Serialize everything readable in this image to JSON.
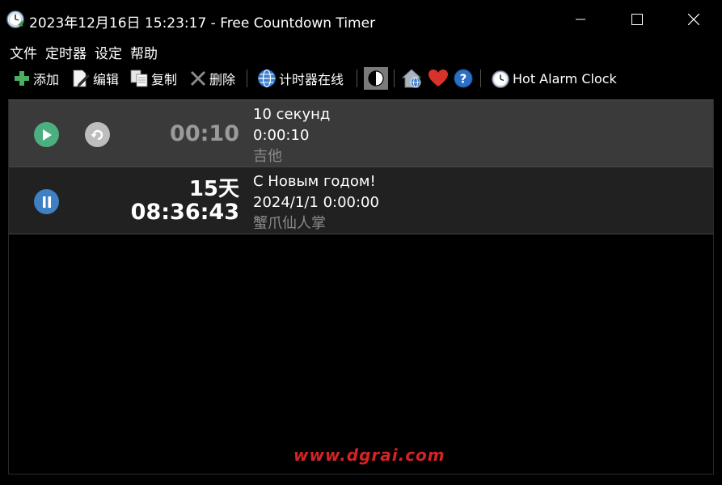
{
  "window": {
    "title": "2023年12月16日 15:23:17 - Free Countdown Timer",
    "minimize_glyph": "—",
    "maximize_glyph": "☐",
    "close_glyph": "✕"
  },
  "menu": [
    {
      "label": "文件"
    },
    {
      "label": "定时器"
    },
    {
      "label": "设定"
    },
    {
      "label": "帮助"
    }
  ],
  "toolbar": {
    "add_label": "添加",
    "edit_label": "编辑",
    "copy_label": "复制",
    "delete_label": "删除",
    "online_label": "计时器在线",
    "hot_alarm_label": "Hot Alarm Clock",
    "icons": [
      "plus-icon",
      "edit-icon",
      "copy-icon",
      "delete-icon",
      "globe-icon",
      "theme-toggle-icon",
      "home-web-icon",
      "heart-icon",
      "help-icon",
      "alarm-clock-icon"
    ]
  },
  "timers": [
    {
      "state": "stopped",
      "remaining": "00:10",
      "name": "10 секунд",
      "target": "0:00:10",
      "sound": "吉他",
      "colors": {
        "play": "#4caf7f",
        "repeat": "#bdbdbd",
        "remaining": "#9a9a9a"
      }
    },
    {
      "state": "running",
      "days": "15天",
      "remaining": "08:36:43",
      "name": "С Новым годом!",
      "target": "2024/1/1 0:00:00",
      "sound": "蟹爪仙人掌",
      "colors": {
        "pause": "#3f7fc4",
        "remaining": "#ffffff"
      }
    }
  ],
  "watermark": "www.dgrai.com"
}
